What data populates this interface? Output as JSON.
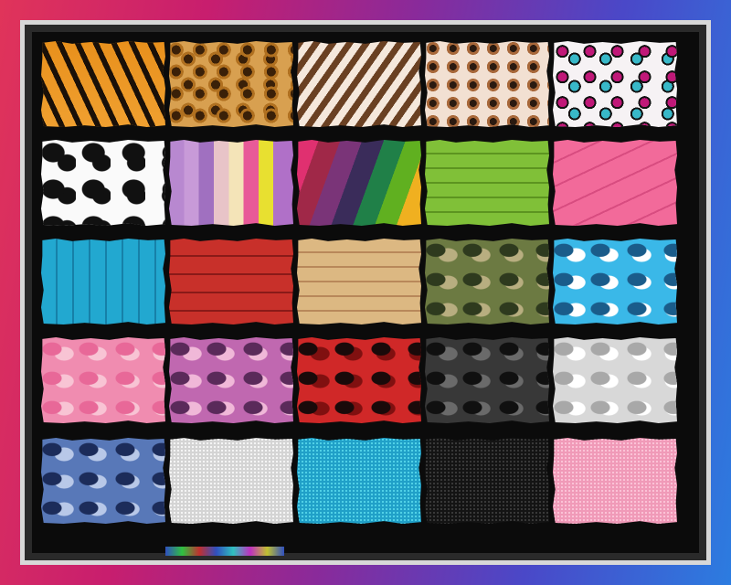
{
  "tiles": [
    {
      "name": "tiger-stripe-tile",
      "pattern": "t-tiger"
    },
    {
      "name": "leopard-print-tile",
      "pattern": "t-leopard"
    },
    {
      "name": "zebra-brown-tile",
      "pattern": "t-zebra"
    },
    {
      "name": "leopard-light-tile",
      "pattern": "t-leopard2"
    },
    {
      "name": "rainbow-leopard-tile",
      "pattern": "t-rainbowleo"
    },
    {
      "name": "cow-print-tile",
      "pattern": "t-cow"
    },
    {
      "name": "pastel-wood-tile",
      "pattern": "t-pastelwood"
    },
    {
      "name": "rainbow-wood-tile",
      "pattern": "t-rainbowwood"
    },
    {
      "name": "green-wood-tile",
      "pattern": "t-greenwood"
    },
    {
      "name": "pink-wood-tile",
      "pattern": "t-pinkwood"
    },
    {
      "name": "blue-wood-tile",
      "pattern": "t-bluewood"
    },
    {
      "name": "red-wood-tile",
      "pattern": "t-redwood"
    },
    {
      "name": "light-wood-tile",
      "pattern": "t-lightwood"
    },
    {
      "name": "green-camo-tile",
      "pattern": "t-camogreen"
    },
    {
      "name": "blue-camo-tile",
      "pattern": "t-camoblue"
    },
    {
      "name": "pink-camo-tile",
      "pattern": "t-camopink"
    },
    {
      "name": "purple-camo-tile",
      "pattern": "t-camopurple"
    },
    {
      "name": "red-camo-tile",
      "pattern": "t-camored"
    },
    {
      "name": "black-camo-tile",
      "pattern": "t-camoblack"
    },
    {
      "name": "white-camo-tile",
      "pattern": "t-camowhite"
    },
    {
      "name": "navy-camo-tile",
      "pattern": "t-camonavy"
    },
    {
      "name": "silver-glitter-tile",
      "pattern": "t-glitsilver"
    },
    {
      "name": "blue-glitter-tile",
      "pattern": "t-glitblue"
    },
    {
      "name": "black-glitter-tile",
      "pattern": "t-glitblack"
    },
    {
      "name": "pink-glitter-tile",
      "pattern": "t-glitpink"
    }
  ],
  "colors": {
    "frame": "#d8d8d8",
    "board": "#0b0b0b"
  }
}
